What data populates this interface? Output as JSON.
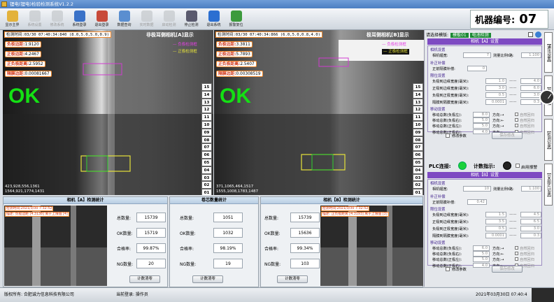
{
  "window": {
    "title": "锂电(锂电)检验检测系统V1.2.2"
  },
  "toolbar": [
    {
      "label": "显示主界",
      "enabled": true,
      "color": "#e3b23c"
    },
    {
      "label": "系统设置",
      "enabled": false,
      "color": "#9aa"
    },
    {
      "label": "修改系统",
      "enabled": false,
      "color": "#9aa"
    },
    {
      "label": "系统登录",
      "enabled": true,
      "color": "#3a72c8"
    },
    {
      "label": "退出登录",
      "enabled": true,
      "color": "#c84a3a"
    },
    {
      "label": "数据查询",
      "enabled": true,
      "color": "#5a8ed0"
    },
    {
      "label": "实时数据",
      "enabled": false,
      "color": "#9aa"
    },
    {
      "label": "启动检测",
      "enabled": false,
      "color": "#9aa"
    },
    {
      "label": "停止检测",
      "enabled": true,
      "color": "#5a5a6e"
    },
    {
      "label": "退出系统",
      "enabled": true,
      "color": "#2b6fd1"
    },
    {
      "label": "报警复位",
      "enabled": true,
      "color": "#3c9a3c"
    }
  ],
  "machine": {
    "label": "机器编号:",
    "number": "07"
  },
  "camA": {
    "timestamp": "检测时间:03/30 07:40:34:840 (8.0,5.0,5.0,0.9)",
    "title": "非极耳侧相机[A]显示",
    "legend": [
      "负极检测框",
      "正极检测框"
    ],
    "measurements": [
      {
        "label": "负极边距:",
        "value": "1.9120"
      },
      {
        "label": "正极边距:",
        "value": "4.2467"
      },
      {
        "label": "正负极距离:",
        "value": "2.5952"
      },
      {
        "label": "隔膜边距:",
        "value": "0.00081667"
      }
    ],
    "result": "OK",
    "coords": [
      "423,928,556,1361",
      "1564,921,1774,1431"
    ]
  },
  "camB": {
    "timestamp": "检测时间:03/30 07:40:34:866 (6.0,5.0,0.8,4.0)",
    "title": "极耳侧相机[B]显示",
    "legend": [
      "负极检测框",
      "正极检测框"
    ],
    "measurements": [
      {
        "label": "负极边距:",
        "value": "3.3811"
      },
      {
        "label": "正极边距:",
        "value": "5.7893"
      },
      {
        "label": "正负极距离:",
        "value": "2.5407"
      },
      {
        "label": "隔膜边距:",
        "value": "0.00308519"
      }
    ],
    "result": "OK",
    "coords": [
      "371,1065,464,1517",
      "1555,1008,1783,1487"
    ]
  },
  "layer_numbers": [
    "15",
    "14",
    "13",
    "12",
    "11",
    "10",
    "09",
    "08",
    "07",
    "06",
    "05",
    "04",
    "03",
    "02",
    "01"
  ],
  "right_panel": {
    "model_label": "请选择模版:",
    "model_value": "模板01",
    "detect_label": "电池检测",
    "camA": {
      "header": "相机【A】设置",
      "param_title": "相机设置",
      "frame_label": "相机幅宽:",
      "frame_value": "7",
      "test_label": "测量比例t路:",
      "test_value": "1.100",
      "comp_title": "补正补偿",
      "comp_label": "正前隔膜补偿:",
      "comp_value": "0",
      "spec_title": "限位设置",
      "specs": [
        {
          "label": "负极到边缘宽度(毫米):",
          "min": "1.0",
          "max": "4.0"
        },
        {
          "label": "正极到边缘宽度(毫米):",
          "min": "3.0",
          "max": "6.0"
        },
        {
          "label": "负极到正极宽度(毫米):",
          "min": "0.5",
          "max": "3.0"
        },
        {
          "label": "隔膜到隔膜宽度(毫米):",
          "min": "0.0001",
          "max": "0.3"
        }
      ],
      "move_title": "移动设置",
      "moves": [
        {
          "label": "移动总数(负极左):",
          "value": "8.0",
          "dir": "方向:→",
          "opt": "自然回归"
        },
        {
          "label": "移动总数(负极右):",
          "value": "5.0",
          "dir": "方向:←",
          "opt": "自然回归"
        },
        {
          "label": "移动总数(正极左):",
          "value": "5.0",
          "dir": "方向:→",
          "opt": "自然回归"
        },
        {
          "label": "移动总数(正极右):",
          "value": "4.0",
          "dir": "方向:←",
          "opt": "自然回归"
        }
      ],
      "modify_label": "修改参数",
      "save_label": "保存修改"
    },
    "plc": {
      "label": "PLC连接:",
      "count_label": "计数指示:",
      "alarm_label": "启用报警",
      "plc_color": "#1bd13a",
      "count_color": "#222"
    },
    "camB": {
      "header": "相机【B】设置",
      "param_title": "相机设置",
      "frame_label": "相机幅宽:",
      "frame_value": "10",
      "test_label": "测量比例t路:",
      "test_value": "1.100",
      "comp_title": "补正补偿",
      "comp_label": "正前隔膜补偿:",
      "comp_value": "0.42",
      "spec_title": "限位设置",
      "specs": [
        {
          "label": "负极到边缘宽度(毫米):",
          "min": "1.5",
          "max": "4.5"
        },
        {
          "label": "正极到边缘宽度(毫米):",
          "min": "3.5",
          "max": "6.5"
        },
        {
          "label": "负极到正极宽度(毫米):",
          "min": "0.5",
          "max": "3.0"
        },
        {
          "label": "隔膜到隔膜宽度(毫米):",
          "min": "0.0001",
          "max": "0.3"
        }
      ],
      "move_title": "移动设置",
      "moves": [
        {
          "label": "移动总数(负极左):",
          "value": "6.0",
          "dir": "方向:→",
          "opt": "自然回归"
        },
        {
          "label": "移动总数(负极右):",
          "value": "5.0",
          "dir": "方向:←",
          "opt": "自然回归"
        },
        {
          "label": "移动总数(正极左):",
          "value": "5.0",
          "dir": "方向:→",
          "opt": "自然回归"
        },
        {
          "label": "移动总数(正极右):",
          "value": "4.0",
          "dir": "方向:←",
          "opt": "自然回归"
        }
      ],
      "modify_label": "修改参数",
      "save_label": "保存修改"
    }
  },
  "side_tabs": [
    "【通讯设置】",
    "【参数设置】",
    "【检测记录】",
    "【OK图片记录】"
  ],
  "statsA": {
    "header": "相机【A】检测统计",
    "thumb_time": "检测时间:2021/3/30 7:32:52",
    "thumb_desc": "描述: 负极边距 [4.3138] 离于上限值 [4]",
    "rows": [
      {
        "label": "总数量:",
        "value": "15739"
      },
      {
        "label": "OK数量:",
        "value": "15719"
      },
      {
        "label": "合格率:",
        "value": "99.87%"
      },
      {
        "label": "NG数量:",
        "value": "20"
      }
    ],
    "clear": "计数清零"
  },
  "statsMid": {
    "header": "卷芯数量统计",
    "rows": [
      {
        "label": "总数量:",
        "value": "1051"
      },
      {
        "label": "OK数量:",
        "value": "1032"
      },
      {
        "label": "合格率:",
        "value": "98.19%"
      },
      {
        "label": "NG数量:",
        "value": "19"
      }
    ],
    "clear": "计数清零"
  },
  "statsB": {
    "header": "相机【B】检测统计",
    "thumb_time": "检测时间:2021/3/30 7:32:52",
    "thumb_desc": "描述: 正负极距离 [4.3193] 离于上限值 [3]",
    "rows": [
      {
        "label": "总数量:",
        "value": "15739"
      },
      {
        "label": "OK数量:",
        "value": "15636"
      },
      {
        "label": "合格率:",
        "value": "99.34%"
      },
      {
        "label": "NG数量:",
        "value": "103"
      }
    ],
    "clear": "计数清零"
  },
  "status": {
    "copyright": "版权所有: 合肥诚力信息科技有限公司",
    "login": "当前登录: 操作员",
    "datetime": "2021年03月30日 07:40:4"
  }
}
